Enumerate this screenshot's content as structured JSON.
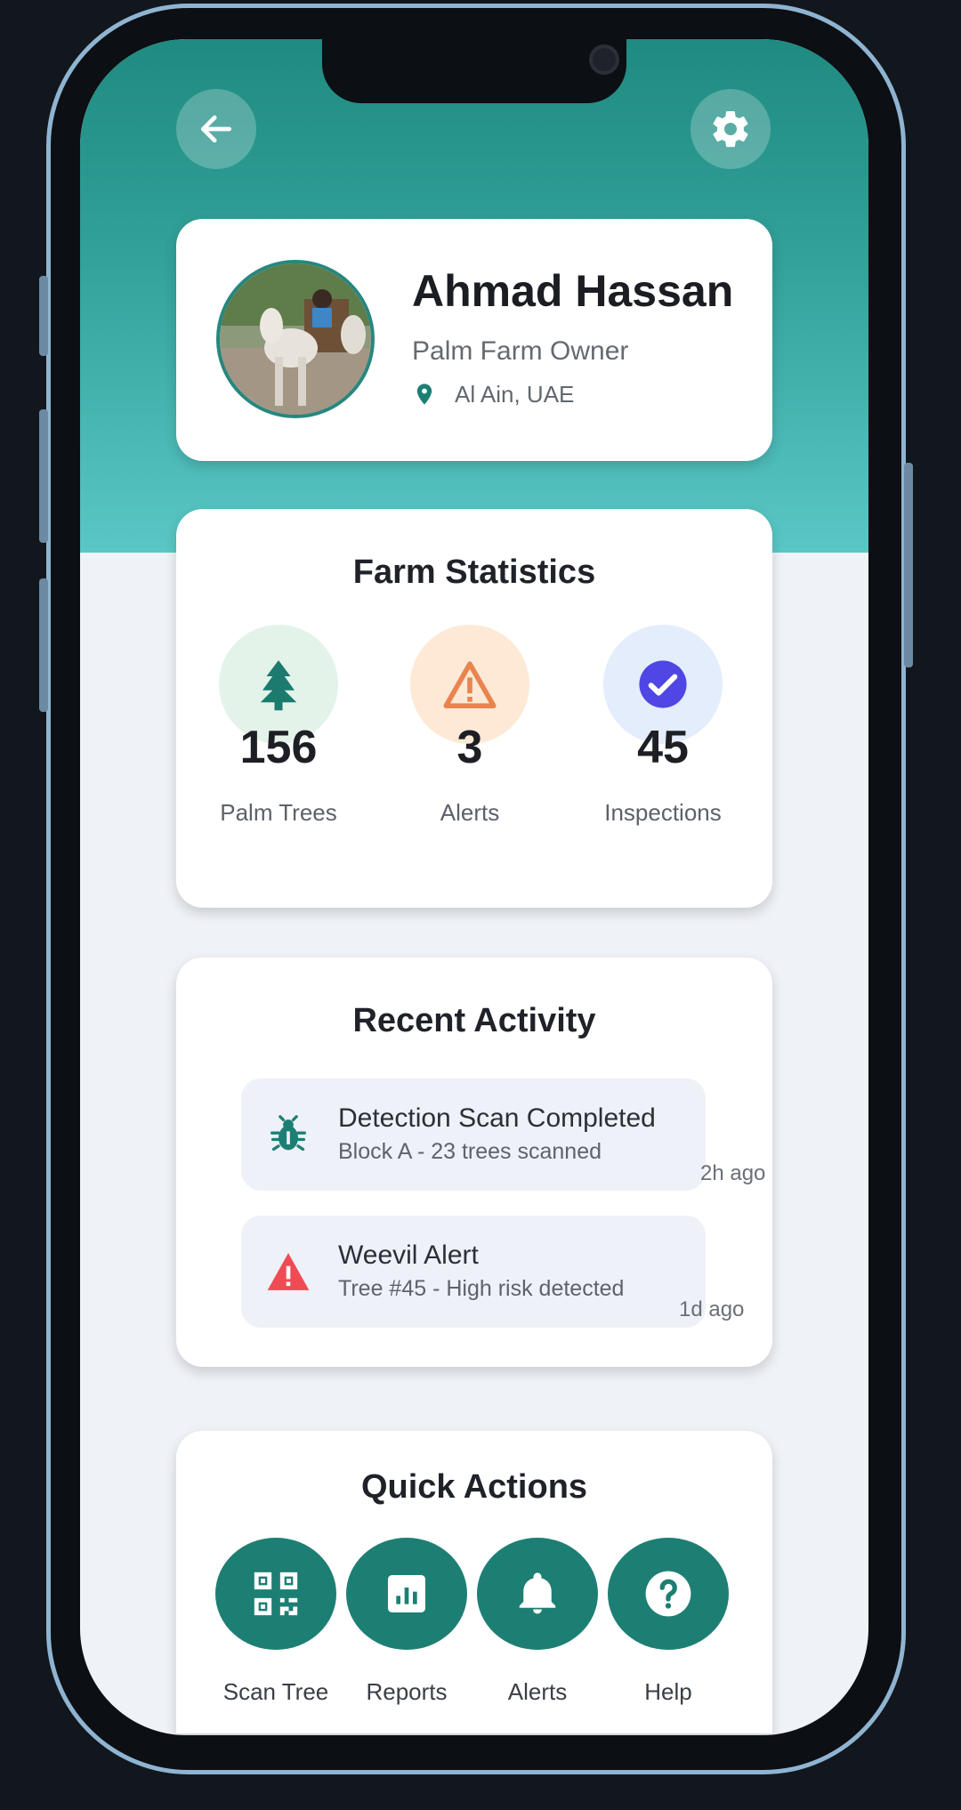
{
  "profile": {
    "name": "Ahmad Hassan",
    "role": "Palm Farm Owner",
    "location": "Al Ain, UAE"
  },
  "stats": {
    "title": "Farm Statistics",
    "items": [
      {
        "value": "156",
        "label": "Palm Trees",
        "icon": "tree-icon",
        "color": "#1c7a6e",
        "bg": "#e3f3ea"
      },
      {
        "value": "3",
        "label": "Alerts",
        "icon": "warning-icon",
        "color": "#e9844f",
        "bg": "#fde9d6"
      },
      {
        "value": "45",
        "label": "Inspections",
        "icon": "check-circle-icon",
        "color": "#4f46e5",
        "bg": "#e3edfb"
      }
    ]
  },
  "activity": {
    "title": "Recent Activity",
    "items": [
      {
        "title": "Detection Scan Completed",
        "subtitle": "Block A - 23 trees scanned",
        "time": "2h ago",
        "icon": "bug-icon",
        "color": "#1d7f73"
      },
      {
        "title": "Weevil Alert",
        "subtitle": "Tree #45 - High risk detected",
        "time": "1d ago",
        "icon": "alert-triangle-icon",
        "color": "#ef4b55"
      }
    ]
  },
  "quick_actions": {
    "title": "Quick Actions",
    "items": [
      {
        "label": "Scan Tree",
        "icon": "qr-code-icon"
      },
      {
        "label": "Reports",
        "icon": "chart-icon"
      },
      {
        "label": "Alerts",
        "icon": "bell-icon"
      },
      {
        "label": "Help",
        "icon": "help-icon"
      }
    ]
  },
  "colors": {
    "primary": "#1d7f73",
    "header_top": "#1f8a80",
    "header_bottom": "#5ac7c6"
  }
}
